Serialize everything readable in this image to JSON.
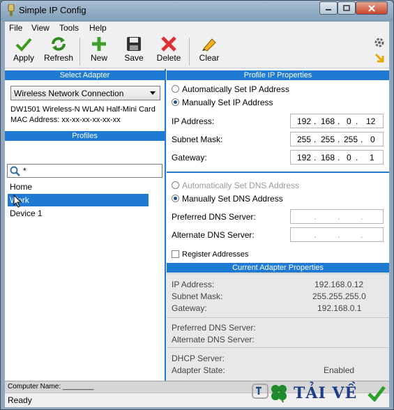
{
  "window": {
    "title": "Simple IP Config"
  },
  "menu": [
    "File",
    "View",
    "Tools",
    "Help"
  ],
  "toolbar": {
    "apply": "Apply",
    "refresh": "Refresh",
    "new": "New",
    "save": "Save",
    "delete": "Delete",
    "clear": "Clear"
  },
  "left": {
    "select_adapter_header": "Select Adapter",
    "adapter_selected": "Wireless Network Connection",
    "adapter_description": "DW1501 Wireless-N WLAN Half-Mini Card",
    "mac_address": "MAC Address: xx-xx-xx-xx-xx-xx",
    "profiles_header": "Profiles",
    "search_value": "*",
    "profiles": [
      "Home",
      "Work",
      "Device 1"
    ]
  },
  "right": {
    "profile_header": "Profile IP Properties",
    "auto_ip": "Automatically Set IP Address",
    "manual_ip": "Manually Set IP Address",
    "ip_label": "IP Address:",
    "subnet_label": "Subnet Mask:",
    "gateway_label": "Gateway:",
    "ip": [
      "192",
      "168",
      "0",
      "12"
    ],
    "subnet": [
      "255",
      "255",
      "255",
      "0"
    ],
    "gateway": [
      "192",
      "168",
      "0",
      "1"
    ],
    "auto_dns": "Automatically Set DNS Address",
    "manual_dns": "Manually Set DNS Address",
    "preferred_dns_label": "Preferred DNS Server:",
    "alternate_dns_label": "Alternate DNS Server:",
    "register_addresses": "Register Addresses",
    "current_header": "Current Adapter Properties",
    "cur_ip_label": "IP Address:",
    "cur_ip": "192.168.0.12",
    "cur_subnet_label": "Subnet Mask:",
    "cur_subnet": "255.255.255.0",
    "cur_gateway_label": "Gateway:",
    "cur_gateway": "192.168.0.1",
    "cur_pref_dns_label": "Preferred DNS Server:",
    "cur_alt_dns_label": "Alternate DNS Server:",
    "dhcp_label": "DHCP Server:",
    "adapter_state_label": "Adapter State:",
    "adapter_state": "Enabled"
  },
  "status": {
    "computer_name": "Computer Name: ________",
    "ready": "Ready"
  },
  "watermark": {
    "text": "TẢI VỀ"
  }
}
